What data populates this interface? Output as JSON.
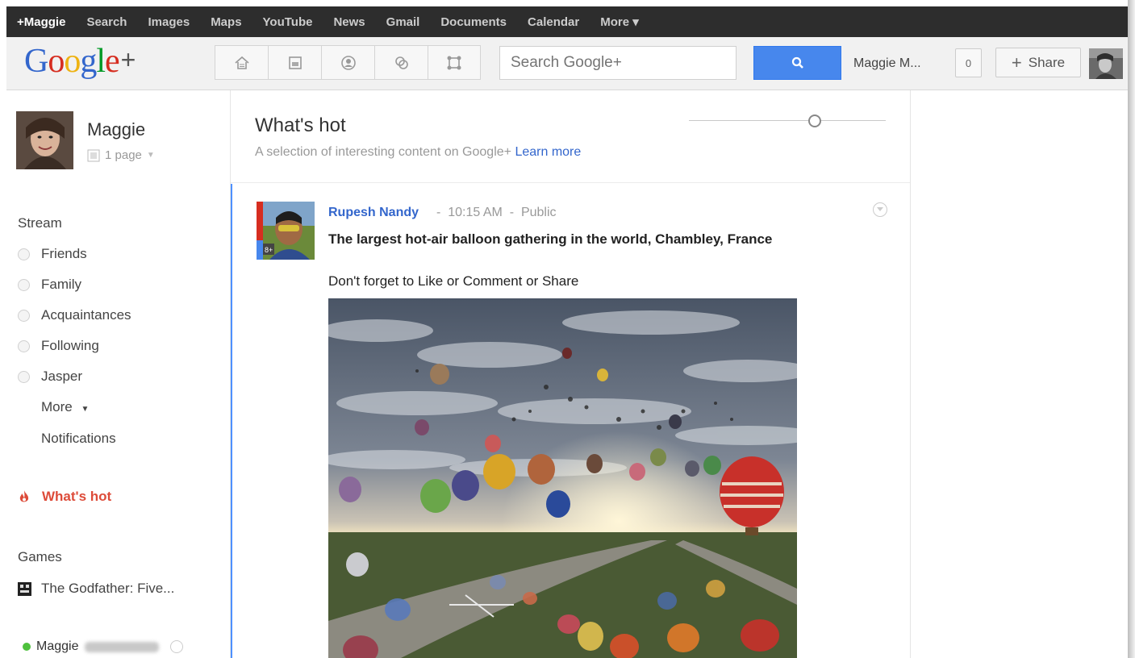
{
  "topbar": {
    "links": [
      "+Maggie",
      "Search",
      "Images",
      "Maps",
      "YouTube",
      "News",
      "Gmail",
      "Documents",
      "Calendar",
      "More ▾"
    ]
  },
  "header": {
    "logo_text": "Google",
    "logo_plus": "+",
    "search_placeholder": "Search Google+",
    "user_name": "Maggie M...",
    "notification_count": "0",
    "share_label": "Share",
    "nav_icons": [
      "home-icon",
      "photos-icon",
      "profile-icon",
      "circles-icon",
      "games-icon"
    ]
  },
  "sidebar": {
    "profile_name": "Maggie",
    "pages_label": "1 page",
    "stream_label": "Stream",
    "circles": [
      "Friends",
      "Family",
      "Acquaintances",
      "Following",
      "Jasper"
    ],
    "more_label": "More",
    "notifications_label": "Notifications",
    "whats_hot_label": "What's hot",
    "games_label": "Games",
    "game_item": "The Godfather: Five...",
    "chat_name": "Maggie"
  },
  "main": {
    "title": "What's hot",
    "subtitle": "A selection of interesting content on Google+",
    "learn_more": "Learn more",
    "slider_level": 0.65
  },
  "post": {
    "author": "Rupesh Nandy",
    "time": "10:15 AM",
    "visibility": "Public",
    "title": "The largest hot-air balloon gathering in the world, Chambley, France",
    "body": "Don't forget to Like or Comment or Share"
  },
  "colors": {
    "accent_blue": "#4787ed",
    "link_blue": "#3366cc",
    "hot_red": "#dd4b39",
    "online_green": "#4ec13d"
  }
}
